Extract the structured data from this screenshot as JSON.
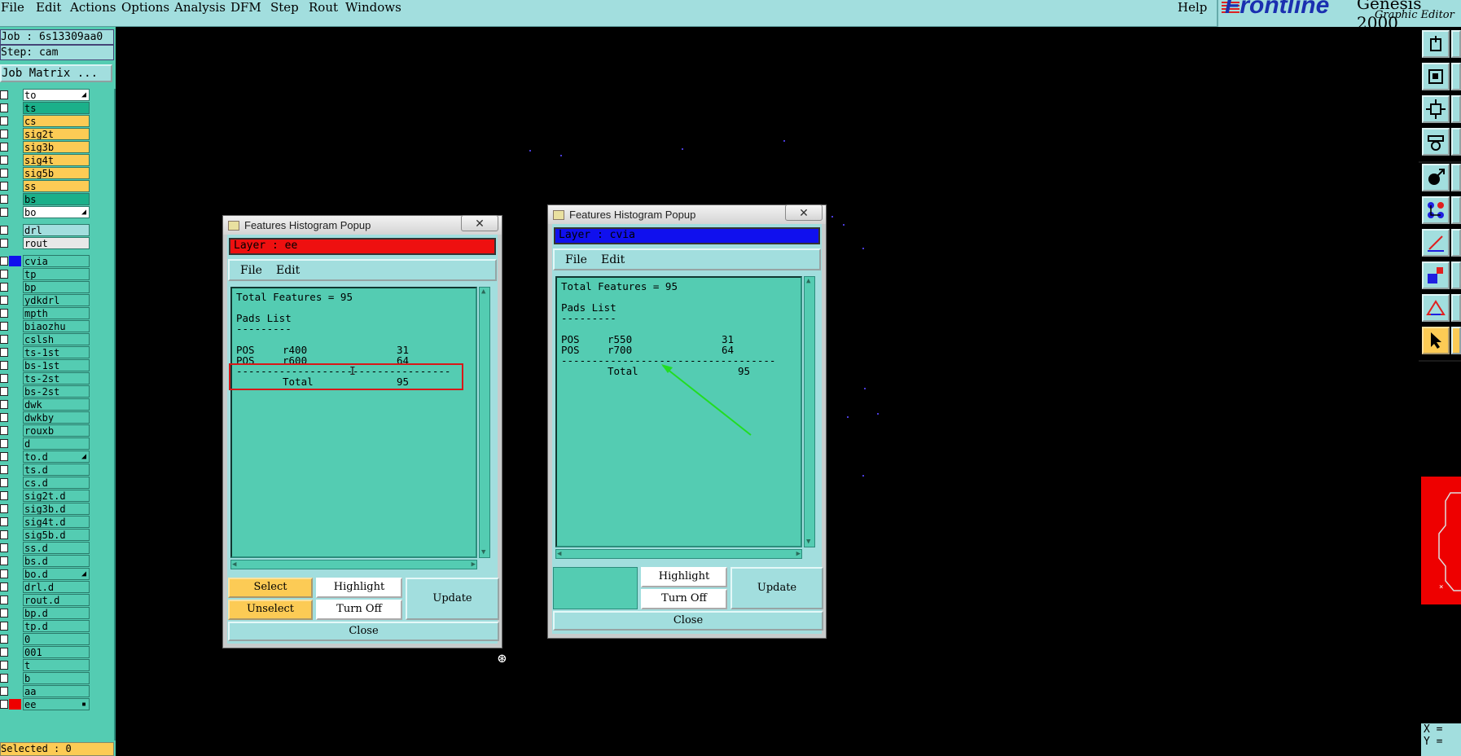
{
  "menubar": {
    "items": [
      "File",
      "Edit",
      "Actions",
      "Options",
      "Analysis",
      "DFM",
      "Step",
      "Rout",
      "Windows"
    ],
    "help": "Help"
  },
  "brand": {
    "logo": "Frontline",
    "product": "Genesis 2000",
    "subtitle": "Graphic Editor"
  },
  "left_panel": {
    "job": "Job : 6s13309aa0",
    "step": "Step: cam",
    "job_matrix": "Job Matrix ...",
    "layers": [
      {
        "name": "to",
        "bg": "#ffffff",
        "mark": "◢"
      },
      {
        "name": "ts",
        "bg": "#1bb08a"
      },
      {
        "name": "cs",
        "bg": "#fccb55"
      },
      {
        "name": "sig2t",
        "bg": "#fccb55"
      },
      {
        "name": "sig3b",
        "bg": "#fccb55"
      },
      {
        "name": "sig4t",
        "bg": "#fccb55"
      },
      {
        "name": "sig5b",
        "bg": "#fccb55"
      },
      {
        "name": "ss",
        "bg": "#fccb55"
      },
      {
        "name": "bs",
        "bg": "#1bb08a"
      },
      {
        "name": "bo",
        "bg": "#ffffff",
        "mark": "◢"
      },
      {
        "name": "drl",
        "bg": "#a2dede"
      },
      {
        "name": "rout",
        "bg": "#e8e8e8"
      },
      {
        "name": "cvia",
        "bg": "#54ccb2",
        "color": "#1010ee"
      },
      {
        "name": "tp",
        "bg": "#54ccb2"
      },
      {
        "name": "bp",
        "bg": "#54ccb2"
      },
      {
        "name": "ydkdrl",
        "bg": "#54ccb2"
      },
      {
        "name": "mpth",
        "bg": "#54ccb2"
      },
      {
        "name": "biaozhu",
        "bg": "#54ccb2"
      },
      {
        "name": "cslsh",
        "bg": "#54ccb2"
      },
      {
        "name": "ts-1st",
        "bg": "#54ccb2"
      },
      {
        "name": "bs-1st",
        "bg": "#54ccb2"
      },
      {
        "name": "ts-2st",
        "bg": "#54ccb2"
      },
      {
        "name": "bs-2st",
        "bg": "#54ccb2"
      },
      {
        "name": "dwk",
        "bg": "#54ccb2"
      },
      {
        "name": "dwkby",
        "bg": "#54ccb2"
      },
      {
        "name": "rouxb",
        "bg": "#54ccb2"
      },
      {
        "name": "d",
        "bg": "#54ccb2"
      },
      {
        "name": "to.d",
        "bg": "#54ccb2",
        "mark": "◢"
      },
      {
        "name": "ts.d",
        "bg": "#54ccb2"
      },
      {
        "name": "cs.d",
        "bg": "#54ccb2"
      },
      {
        "name": "sig2t.d",
        "bg": "#54ccb2"
      },
      {
        "name": "sig3b.d",
        "bg": "#54ccb2"
      },
      {
        "name": "sig4t.d",
        "bg": "#54ccb2"
      },
      {
        "name": "sig5b.d",
        "bg": "#54ccb2"
      },
      {
        "name": "ss.d",
        "bg": "#54ccb2"
      },
      {
        "name": "bs.d",
        "bg": "#54ccb2"
      },
      {
        "name": "bo.d",
        "bg": "#54ccb2",
        "mark": "◢"
      },
      {
        "name": "drl.d",
        "bg": "#54ccb2"
      },
      {
        "name": "rout.d",
        "bg": "#54ccb2"
      },
      {
        "name": "bp.d",
        "bg": "#54ccb2"
      },
      {
        "name": "tp.d",
        "bg": "#54ccb2"
      },
      {
        "name": "0",
        "bg": "#54ccb2"
      },
      {
        "name": "001",
        "bg": "#54ccb2"
      },
      {
        "name": "t",
        "bg": "#54ccb2"
      },
      {
        "name": "b",
        "bg": "#54ccb2"
      },
      {
        "name": "aa",
        "bg": "#54ccb2"
      },
      {
        "name": "ee",
        "bg": "#54ccb2",
        "color": "#ee0000",
        "mark": "▪"
      }
    ],
    "selected": "Selected : 0"
  },
  "popup1": {
    "title": "Features Histogram Popup",
    "close_x": "✕",
    "layer_label": "Layer :  ee",
    "layer_color": "#ee1010",
    "menu": [
      "File",
      "Edit"
    ],
    "content": {
      "total": "Total Features = 95",
      "heading": "Pads List",
      "underline": "---------",
      "rows": [
        {
          "type": "POS",
          "symbol": "r400",
          "count": "31"
        },
        {
          "type": "POS",
          "symbol": "r600",
          "count": "64"
        }
      ],
      "divider": "-----------------------------------",
      "total_label": "Total",
      "total_value": "95"
    },
    "buttons": {
      "select": "Select",
      "unselect": "Unselect",
      "highlight": "Highlight",
      "turn_off": "Turn Off",
      "update": "Update",
      "close": "Close"
    }
  },
  "popup2": {
    "title": "Features Histogram Popup",
    "close_x": "✕",
    "layer_label": "Layer :  cvia",
    "layer_color": "#1010ee",
    "menu": [
      "File",
      "Edit"
    ],
    "content": {
      "total": "Total Features = 95",
      "heading": "Pads List",
      "underline": "---------",
      "rows": [
        {
          "type": "POS",
          "symbol": "r550",
          "count": "31"
        },
        {
          "type": "POS",
          "symbol": "r700",
          "count": "64"
        }
      ],
      "divider": "-----------------------------------",
      "total_label": "Total",
      "total_value": "95"
    },
    "buttons": {
      "highlight": "Highlight",
      "turn_off": "Turn Off",
      "update": "Update",
      "close": "Close"
    }
  },
  "coords": {
    "x": "X =",
    "y": "Y ="
  },
  "cursor_icon": "crosshair-cursor-icon",
  "annotation_color_red": "#d81818",
  "annotation_color_green": "#22dd22"
}
